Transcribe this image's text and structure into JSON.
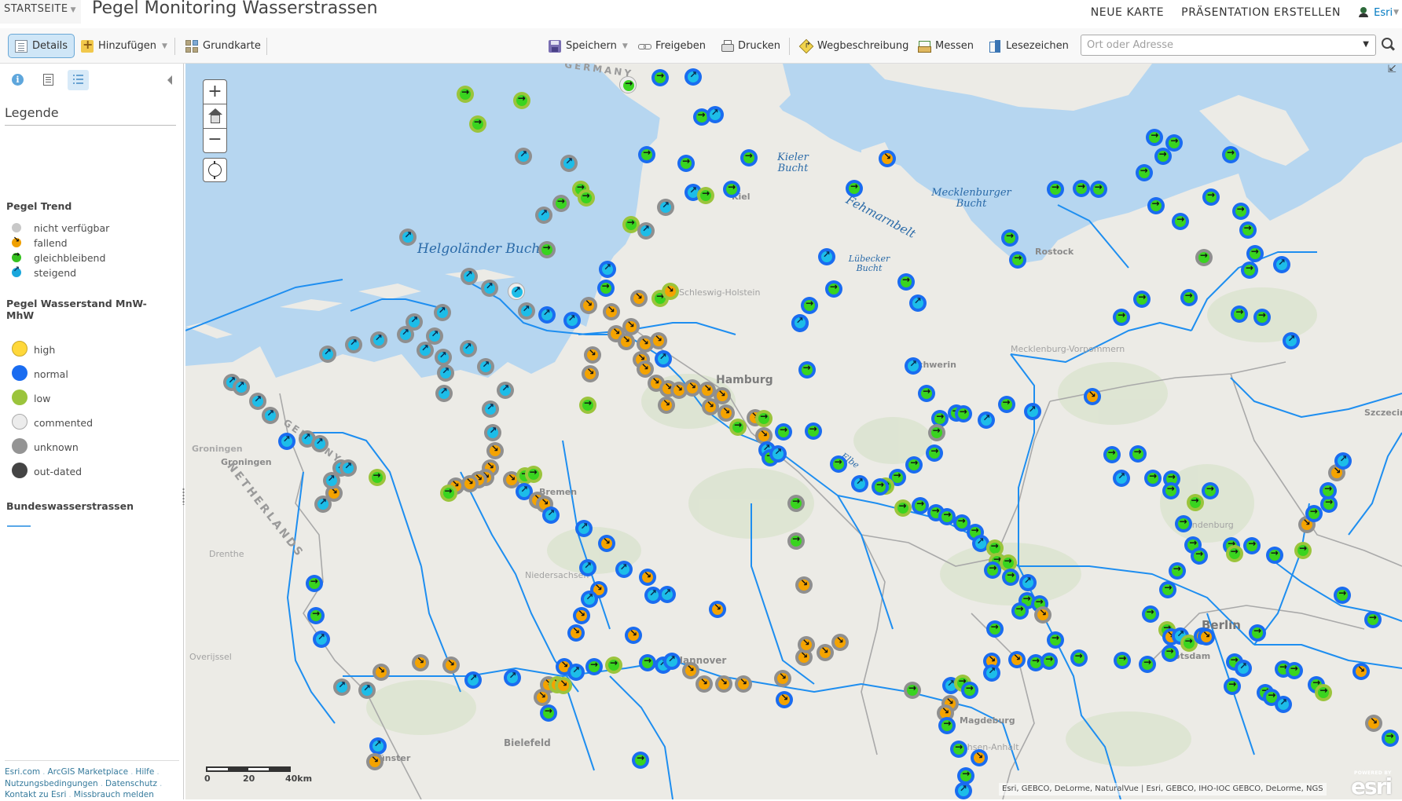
{
  "header": {
    "home_menu": "STARTSEITE",
    "title": "Pegel Monitoring Wasserstrassen",
    "links": [
      "NEUE KARTE",
      "PRÄSENTATION ERSTELLEN"
    ],
    "user": "Esri"
  },
  "toolbar": {
    "details": "Details",
    "add": "Hinzufügen",
    "basemap": "Grundkarte",
    "save": "Speichern",
    "share": "Freigeben",
    "print": "Drucken",
    "directions": "Wegbeschreibung",
    "measure": "Messen",
    "bookmarks": "Lesezeichen",
    "search_placeholder": "Ort oder Adresse",
    "search_value": ""
  },
  "sidebar": {
    "tabs": [
      "Info",
      "Inhalt",
      "Legende"
    ],
    "active_tab": "Legende",
    "legend_title": "Legende",
    "groups": [
      {
        "title": "Pegel Trend",
        "items": [
          {
            "label": "nicht verfügbar",
            "symbol": "trend-na"
          },
          {
            "label": "fallend",
            "symbol": "trend-down"
          },
          {
            "label": "gleichbleibend",
            "symbol": "trend-flat"
          },
          {
            "label": "steigend",
            "symbol": "trend-up"
          }
        ]
      },
      {
        "title": "Pegel Wasserstand MnW-MhW",
        "items": [
          {
            "label": "high",
            "color": "#ffd83a"
          },
          {
            "label": "normal",
            "color": "#1a6cf0"
          },
          {
            "label": "low",
            "color": "#9bc43c"
          },
          {
            "label": "commented",
            "color": "#ececec"
          },
          {
            "label": "unknown",
            "color": "#949494"
          },
          {
            "label": "out-dated",
            "color": "#444444"
          }
        ]
      },
      {
        "title": "Bundeswasserstrassen",
        "line_color": "#58a7e8"
      }
    ],
    "footer_links": [
      "Esri.com",
      "ArcGIS Marketplace",
      "Hilfe",
      "Nutzungsbedingungen",
      "Datenschutz",
      "Kontakt zu Esri",
      "Missbrauch melden"
    ]
  },
  "map": {
    "labels": {
      "seas": [
        "Helgoländer Bucht",
        "Kieler Bucht",
        "Fehmarnbelt",
        "Mecklenburger Bucht",
        "Lübecker Bucht"
      ],
      "cities": [
        "Hamburg",
        "Rostock",
        "Schwerin",
        "Bremen",
        "Hannover",
        "Magdeburg",
        "Berlin",
        "Potsdam",
        "Bielefeld",
        "Münster",
        "Groningen",
        "Groningen",
        "Kiel",
        "Szczecin",
        "Elbe"
      ],
      "regions": [
        "Schleswig-Holstein",
        "Mecklenburg-Vorpommern",
        "Niedersachsen",
        "Brandenburg",
        "Sachsen-Anhalt",
        "Drenthe",
        "Overijssel"
      ],
      "countries": [
        "GERMANY",
        "NETHERLANDS",
        "GERMANY"
      ]
    },
    "scale": {
      "ticks": [
        "0",
        "20",
        "40km"
      ]
    },
    "attribution": "Esri, GEBCO, DeLorme, NaturalVue | Esri, GEBCO, IHO-IOC GEBCO, DeLorme, NGS",
    "logo": {
      "powered_by": "POWERED BY",
      "brand": "esri"
    },
    "colors": {
      "water": "#b6d6f0",
      "land": "#ecebe6",
      "waterway": "#1e8ef0",
      "level_normal": "#1a6cf0",
      "level_unknown": "#8f8f8f",
      "level_low": "#9bc43c",
      "level_high": "#ffd83a",
      "trend_up": "#1dbde8",
      "trend_down": "#f4a300",
      "trend_flat": "#39d41f"
    }
  }
}
